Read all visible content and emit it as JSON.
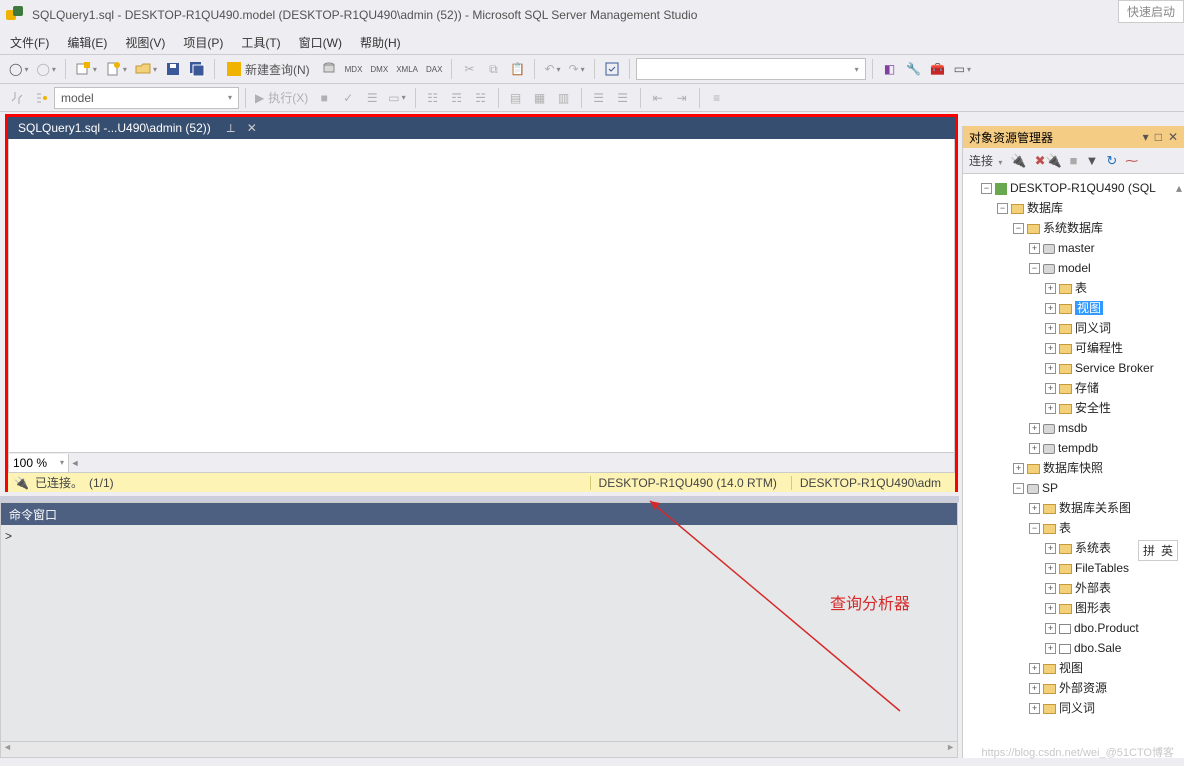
{
  "title": "SQLQuery1.sql - DESKTOP-R1QU490.model (DESKTOP-R1QU490\\admin (52)) - Microsoft SQL Server Management Studio",
  "quick_launch": "快速启动",
  "menu": {
    "file": "文件(F)",
    "edit": "编辑(E)",
    "view": "视图(V)",
    "project": "项目(P)",
    "tools": "工具(T)",
    "window": "窗口(W)",
    "help": "帮助(H)"
  },
  "toolbar": {
    "new_query": "新建查询(N)",
    "execute": "执行(X)",
    "mdx": "MDX",
    "dmx": "DMX",
    "xmla": "XMLA",
    "dax": "DAX"
  },
  "db_combo": "model",
  "doc_tab": "SQLQuery1.sql -...U490\\admin (52))",
  "zoom": "100 %",
  "status": {
    "connected": "已连接。",
    "progress": "(1/1)",
    "server": "DESKTOP-R1QU490 (14.0 RTM)",
    "user": "DESKTOP-R1QU490\\adm"
  },
  "cmd_title": "命令窗口",
  "cmd_prompt": ">",
  "annotation": "查询分析器",
  "obj_explorer": {
    "title": "对象资源管理器",
    "connect": "连接",
    "server": "DESKTOP-R1QU490 (SQL",
    "databases": "数据库",
    "sys_databases": "系统数据库",
    "master": "master",
    "model": "model",
    "tables": "表",
    "views": "视图",
    "synonyms": "同义词",
    "programmability": "可编程性",
    "service_broker": "Service Broker",
    "storage": "存储",
    "security": "安全性",
    "msdb": "msdb",
    "tempdb": "tempdb",
    "db_snapshots": "数据库快照",
    "sp": "SP",
    "db_diagrams": "数据库关系图",
    "sp_tables": "表",
    "sys_tables": "系统表",
    "filetables": "FileTables",
    "external_tables": "外部表",
    "graph_tables": "图形表",
    "dbo_product": "dbo.Product",
    "dbo_sale": "dbo.Sale",
    "sp_views": "视图",
    "external_resources": "外部资源",
    "sp_synonyms": "同义词"
  },
  "ime": {
    "pin": "拼",
    "lang": "英"
  },
  "watermark": "https://blog.csdn.net/wei_@51CTO博客"
}
